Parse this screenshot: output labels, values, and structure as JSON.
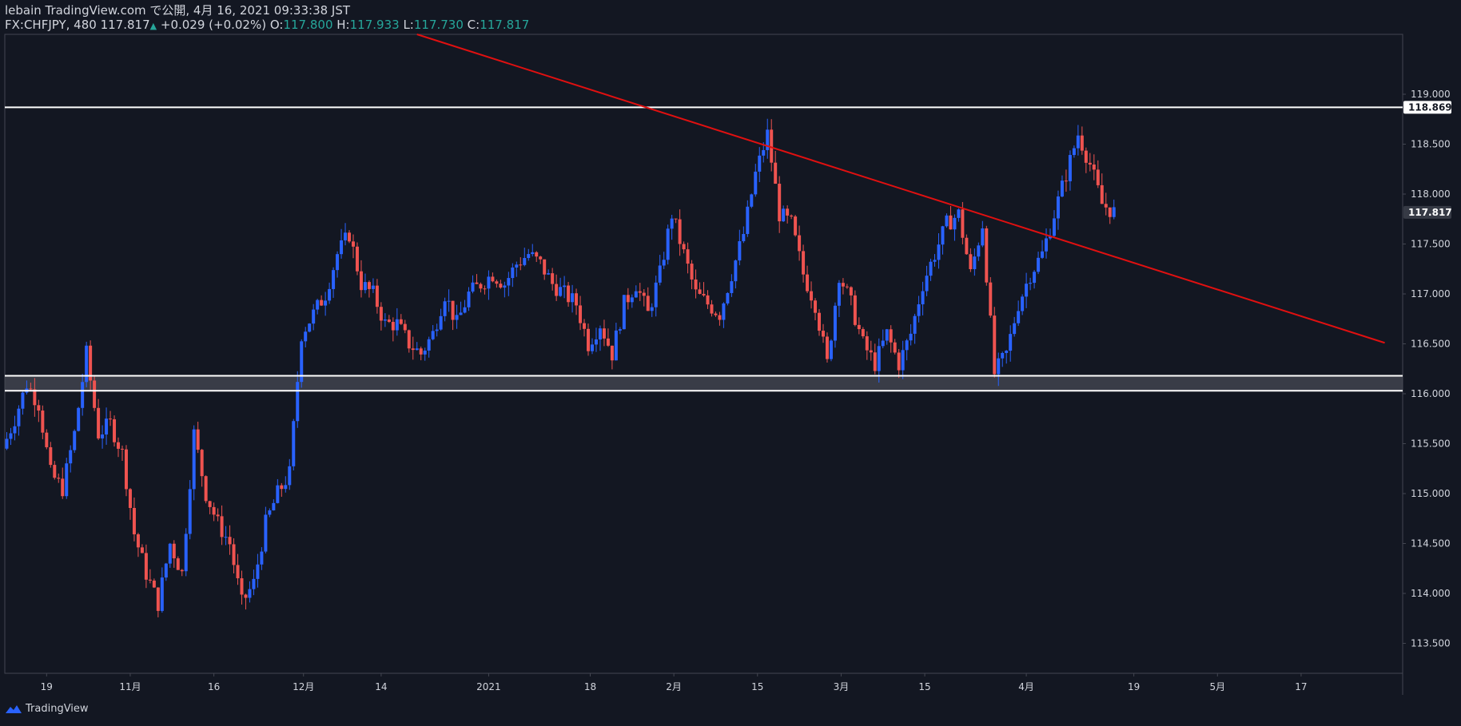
{
  "header": {
    "line1": "lebain TradingView.com で公開, 4月 16, 2021 09:33:38 JST",
    "symbol": "FX:CHFJPY, 480",
    "last": "117.817",
    "change": "+0.029 (+0.02%)",
    "o_label": "O:",
    "o_value": "117.800",
    "h_label": "H:",
    "h_value": "117.933",
    "l_label": "L:",
    "l_value": "117.730",
    "c_label": "C:",
    "c_value": "117.817"
  },
  "footer": {
    "brand": "TradingView"
  },
  "colors": {
    "background": "#131722",
    "up": "#2962ff",
    "down": "#ef5350",
    "trendline": "#e01010",
    "level": "#ffffff",
    "zone_fill": "#4a4d57",
    "axis_text": "#d1d4dc"
  },
  "chart_data": {
    "type": "candlestick",
    "y_ticks": [
      113.5,
      114.0,
      114.5,
      115.0,
      115.5,
      116.0,
      116.5,
      117.0,
      117.5,
      118.0,
      118.5,
      119.0
    ],
    "y_tick_labels": [
      "113.500",
      "114.000",
      "114.500",
      "115.000",
      "115.500",
      "116.000",
      "116.500",
      "117.000",
      "117.500",
      "118.000",
      "118.500",
      "119.000"
    ],
    "ylim": [
      113.2,
      119.6
    ],
    "x_tick_labels": [
      "19",
      "11月",
      "16",
      "12月",
      "14",
      "2021",
      "18",
      "2月",
      "15",
      "3月",
      "15",
      "4月",
      "19",
      "5月",
      "17"
    ],
    "x_tick_dates": [
      "2020-10-19",
      "2020-11-02",
      "2020-11-16",
      "2020-12-01",
      "2020-12-14",
      "2021-01-01",
      "2021-01-18",
      "2021-02-01",
      "2021-02-15",
      "2021-03-01",
      "2021-03-15",
      "2021-04-01",
      "2021-04-19",
      "2021-05-03",
      "2021-05-17"
    ],
    "price_labels": [
      {
        "text": "118.869",
        "value": 118.869,
        "style": "level"
      },
      {
        "text": "117.817",
        "value": 117.817,
        "style": "last"
      }
    ],
    "levels": [
      {
        "name": "resistance",
        "value": 118.869
      },
      {
        "name": "support-top",
        "value": 116.18
      },
      {
        "name": "support-bottom",
        "value": 116.03
      }
    ],
    "trendline": {
      "start": {
        "date": "2020-12-20",
        "price": 119.6
      },
      "end": {
        "date": "2021-05-31",
        "price": 116.51
      }
    },
    "grid": false,
    "closes": [
      {
        "date": "2020-10-12",
        "close": 115.45
      },
      {
        "date": "2020-10-14",
        "close": 115.75
      },
      {
        "date": "2020-10-16",
        "close": 116.1
      },
      {
        "date": "2020-10-18",
        "close": 115.9
      },
      {
        "date": "2020-10-20",
        "close": 115.2
      },
      {
        "date": "2020-10-22",
        "close": 115.05
      },
      {
        "date": "2020-10-24",
        "close": 115.6
      },
      {
        "date": "2020-10-26",
        "close": 116.4
      },
      {
        "date": "2020-10-28",
        "close": 115.6
      },
      {
        "date": "2020-10-30",
        "close": 115.7
      },
      {
        "date": "2020-11-01",
        "close": 115.4
      },
      {
        "date": "2020-11-03",
        "close": 114.6
      },
      {
        "date": "2020-11-05",
        "close": 114.2
      },
      {
        "date": "2020-11-07",
        "close": 113.9
      },
      {
        "date": "2020-11-09",
        "close": 114.5
      },
      {
        "date": "2020-11-11",
        "close": 114.2
      },
      {
        "date": "2020-11-13",
        "close": 115.6
      },
      {
        "date": "2020-11-15",
        "close": 115.0
      },
      {
        "date": "2020-11-17",
        "close": 114.7
      },
      {
        "date": "2020-11-19",
        "close": 114.5
      },
      {
        "date": "2020-11-21",
        "close": 113.9
      },
      {
        "date": "2020-11-23",
        "close": 114.1
      },
      {
        "date": "2020-11-25",
        "close": 114.7
      },
      {
        "date": "2020-11-27",
        "close": 115.0
      },
      {
        "date": "2020-11-29",
        "close": 115.2
      },
      {
        "date": "2020-12-01",
        "close": 116.6
      },
      {
        "date": "2020-12-03",
        "close": 116.8
      },
      {
        "date": "2020-12-05",
        "close": 117.0
      },
      {
        "date": "2020-12-07",
        "close": 117.4
      },
      {
        "date": "2020-12-09",
        "close": 117.6
      },
      {
        "date": "2020-12-11",
        "close": 117.1
      },
      {
        "date": "2020-12-13",
        "close": 117.0
      },
      {
        "date": "2020-12-15",
        "close": 116.7
      },
      {
        "date": "2020-12-17",
        "close": 116.7
      },
      {
        "date": "2020-12-19",
        "close": 116.5
      },
      {
        "date": "2020-12-21",
        "close": 116.4
      },
      {
        "date": "2020-12-23",
        "close": 116.6
      },
      {
        "date": "2020-12-25",
        "close": 117.0
      },
      {
        "date": "2020-12-27",
        "close": 116.7
      },
      {
        "date": "2020-12-29",
        "close": 117.0
      },
      {
        "date": "2020-12-31",
        "close": 117.1
      },
      {
        "date": "2021-01-02",
        "close": 117.2
      },
      {
        "date": "2021-01-04",
        "close": 117.1
      },
      {
        "date": "2021-01-06",
        "close": 117.3
      },
      {
        "date": "2021-01-08",
        "close": 117.4
      },
      {
        "date": "2021-01-10",
        "close": 117.3
      },
      {
        "date": "2021-01-12",
        "close": 117.1
      },
      {
        "date": "2021-01-14",
        "close": 117.0
      },
      {
        "date": "2021-01-16",
        "close": 116.9
      },
      {
        "date": "2021-01-18",
        "close": 116.5
      },
      {
        "date": "2021-01-20",
        "close": 116.7
      },
      {
        "date": "2021-01-22",
        "close": 116.4
      },
      {
        "date": "2021-01-24",
        "close": 116.9
      },
      {
        "date": "2021-01-26",
        "close": 117.1
      },
      {
        "date": "2021-01-28",
        "close": 116.8
      },
      {
        "date": "2021-01-30",
        "close": 117.2
      },
      {
        "date": "2021-02-01",
        "close": 117.8
      },
      {
        "date": "2021-02-03",
        "close": 117.4
      },
      {
        "date": "2021-02-05",
        "close": 117.0
      },
      {
        "date": "2021-02-07",
        "close": 116.9
      },
      {
        "date": "2021-02-09",
        "close": 116.8
      },
      {
        "date": "2021-02-11",
        "close": 117.2
      },
      {
        "date": "2021-02-13",
        "close": 117.6
      },
      {
        "date": "2021-02-15",
        "close": 118.2
      },
      {
        "date": "2021-02-17",
        "close": 118.6
      },
      {
        "date": "2021-02-19",
        "close": 117.8
      },
      {
        "date": "2021-02-21",
        "close": 117.7
      },
      {
        "date": "2021-02-23",
        "close": 117.2
      },
      {
        "date": "2021-02-25",
        "close": 116.9
      },
      {
        "date": "2021-02-27",
        "close": 116.3
      },
      {
        "date": "2021-03-01",
        "close": 117.2
      },
      {
        "date": "2021-03-03",
        "close": 116.9
      },
      {
        "date": "2021-03-05",
        "close": 116.5
      },
      {
        "date": "2021-03-07",
        "close": 116.3
      },
      {
        "date": "2021-03-09",
        "close": 116.6
      },
      {
        "date": "2021-03-11",
        "close": 116.3
      },
      {
        "date": "2021-03-13",
        "close": 116.6
      },
      {
        "date": "2021-03-15",
        "close": 117.1
      },
      {
        "date": "2021-03-17",
        "close": 117.4
      },
      {
        "date": "2021-03-19",
        "close": 117.7
      },
      {
        "date": "2021-03-21",
        "close": 117.8
      },
      {
        "date": "2021-03-23",
        "close": 117.2
      },
      {
        "date": "2021-03-25",
        "close": 117.7
      },
      {
        "date": "2021-03-27",
        "close": 116.2
      },
      {
        "date": "2021-03-29",
        "close": 116.4
      },
      {
        "date": "2021-03-31",
        "close": 116.9
      },
      {
        "date": "2021-04-02",
        "close": 117.2
      },
      {
        "date": "2021-04-04",
        "close": 117.4
      },
      {
        "date": "2021-04-06",
        "close": 117.8
      },
      {
        "date": "2021-04-08",
        "close": 118.2
      },
      {
        "date": "2021-04-10",
        "close": 118.6
      },
      {
        "date": "2021-04-12",
        "close": 118.3
      },
      {
        "date": "2021-04-14",
        "close": 117.9
      },
      {
        "date": "2021-04-16",
        "close": 117.82
      }
    ]
  }
}
